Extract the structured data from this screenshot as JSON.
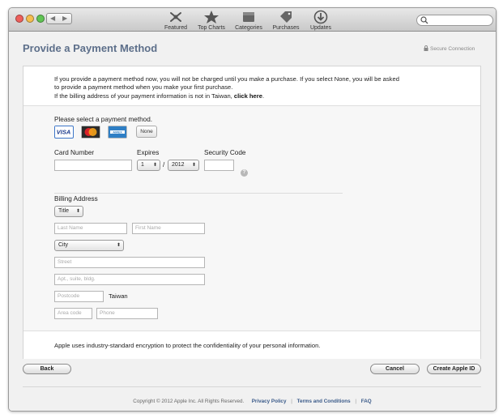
{
  "window": {
    "traffic_colors": [
      "#ee5f5b",
      "#f5be4f",
      "#60c454"
    ]
  },
  "toolbar": {
    "back_glyph": "◀",
    "forward_glyph": "▶",
    "items": [
      {
        "label": "Featured",
        "icon": "featured-icon"
      },
      {
        "label": "Top Charts",
        "icon": "star-icon"
      },
      {
        "label": "Categories",
        "icon": "categories-icon"
      },
      {
        "label": "Purchases",
        "icon": "tag-icon"
      },
      {
        "label": "Updates",
        "icon": "updates-icon"
      }
    ],
    "search_placeholder": ""
  },
  "page": {
    "title": "Provide a Payment Method",
    "secure_label": "Secure Connection"
  },
  "intro": {
    "line1": "If you provide a payment method now, you will not be charged until you make a purchase. If you select None, you will be asked",
    "line2": "to provide a payment method when you make your first purchase.",
    "line3_prefix": "If the billing address of your payment information is not in Taiwan,",
    "line3_link": "click here",
    "line3_suffix": "."
  },
  "payment": {
    "prompt": "Please select a payment method.",
    "cards": [
      {
        "label": "VISA",
        "icon": "visa-icon",
        "selected": true
      },
      {
        "label": "MasterCard",
        "icon": "mastercard-icon",
        "selected": false
      },
      {
        "label": "AMEX",
        "icon": "amex-icon",
        "selected": false
      }
    ],
    "none_label": "None",
    "card_number_label": "Card Number",
    "card_number_value": "",
    "expires_label": "Expires",
    "expires_month": "1",
    "expires_separator": "/",
    "expires_year": "2012",
    "security_code_label": "Security Code",
    "security_code_value": "",
    "help_glyph": "?"
  },
  "billing": {
    "heading": "Billing Address",
    "title_select": "Title",
    "last_name_placeholder": "Last Name",
    "first_name_placeholder": "First Name",
    "city_select": "City",
    "street_placeholder": "Street",
    "apt_placeholder": "Apt., suite, bldg.",
    "postcode_placeholder": "Postcode",
    "country": "Taiwan",
    "area_code_placeholder": "Area code",
    "phone_placeholder": "Phone"
  },
  "security_note": "Apple uses industry-standard encryption to protect the confidentiality of your personal information.",
  "buttons": {
    "back": "Back",
    "cancel": "Cancel",
    "create": "Create Apple ID"
  },
  "footer": {
    "copyright": "Copyright © 2012 Apple Inc. All Rights Reserved.",
    "links": [
      "Privacy Policy",
      "Terms and Conditions",
      "FAQ"
    ],
    "separator": "|"
  }
}
